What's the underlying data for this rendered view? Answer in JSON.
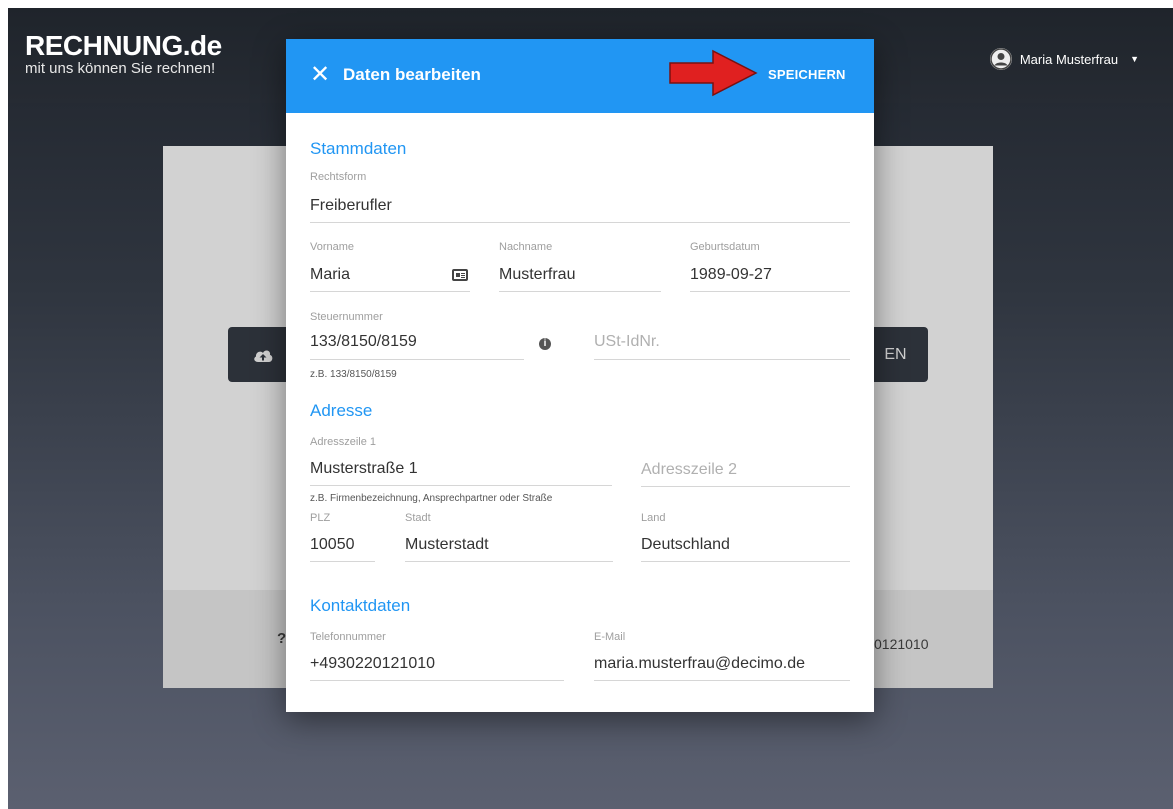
{
  "app": {
    "logo_title": "RECHNUNG.de",
    "logo_tagline": "mit uns können Sie rechnen!",
    "user_name": "Maria Musterfrau"
  },
  "background": {
    "button_right_text": "EN",
    "footer_question": "?",
    "footer_number": "0121010"
  },
  "modal": {
    "title": "Daten bearbeiten",
    "save_label": "SPEICHERN",
    "sections": {
      "stammdaten": "Stammdaten",
      "adresse": "Adresse",
      "kontakt": "Kontaktdaten"
    },
    "fields": {
      "rechtsform": {
        "label": "Rechtsform",
        "value": "Freiberufler"
      },
      "vorname": {
        "label": "Vorname",
        "value": "Maria"
      },
      "nachname": {
        "label": "Nachname",
        "value": "Musterfrau"
      },
      "geburtsdatum": {
        "label": "Geburtsdatum",
        "value": "1989-09-27"
      },
      "steuernummer": {
        "label": "Steuernummer",
        "value": "133/8150/8159",
        "hint": "z.B. 133/8150/8159"
      },
      "ust": {
        "placeholder": "USt-IdNr."
      },
      "adresszeile1": {
        "label": "Adresszeile 1",
        "value": "Musterstraße 1",
        "hint": "z.B. Firmenbezeichnung, Ansprechpartner oder Straße"
      },
      "adresszeile2": {
        "placeholder": "Adresszeile 2"
      },
      "plz": {
        "label": "PLZ",
        "value": "10050"
      },
      "stadt": {
        "label": "Stadt",
        "value": "Musterstadt"
      },
      "land": {
        "label": "Land",
        "value": "Deutschland"
      },
      "telefon": {
        "label": "Telefonnummer",
        "value": "+4930220121010"
      },
      "email": {
        "label": "E-Mail",
        "value": "maria.musterfrau@decimo.de"
      }
    }
  },
  "colors": {
    "accent": "#2196f3",
    "arrow": "#e02020"
  },
  "icons": {
    "close": "close-icon",
    "arrow": "red-arrow-annotation",
    "id_card": "id-card-icon",
    "info": "info-icon",
    "upload": "cloud-upload-icon",
    "avatar": "user-avatar-icon"
  }
}
